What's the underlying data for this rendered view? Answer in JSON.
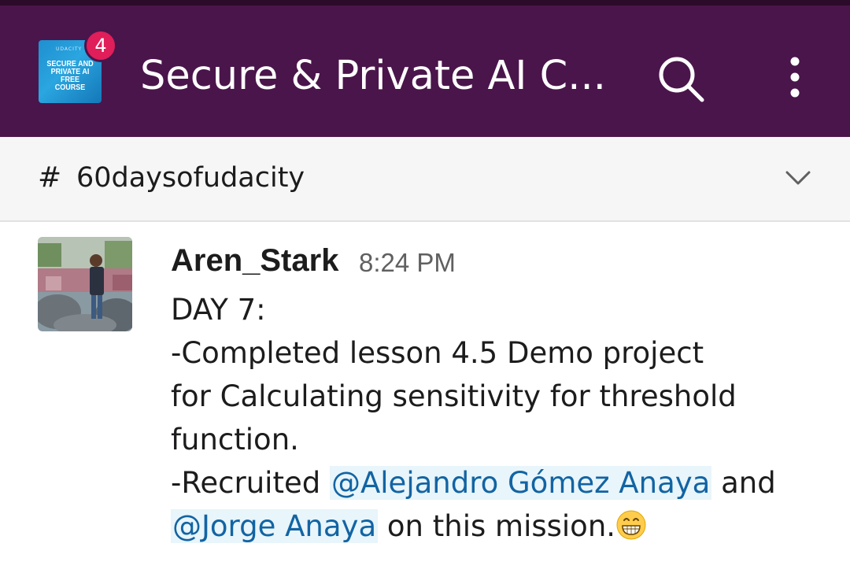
{
  "header": {
    "workspace_logo_text": "SECURE AND PRIVATE AI FREE COURSE",
    "workspace_logo_mark": "UDACITY",
    "notification_count": "4",
    "workspace_title": "Secure & Private AI C...",
    "search_icon": "search-icon",
    "more_icon": "more-vertical-icon",
    "background_color": "#4a154b",
    "badge_color": "#e01e5a"
  },
  "channel": {
    "hash": "#",
    "name": "60daysofudacity",
    "chevron_icon": "chevron-down-icon"
  },
  "message": {
    "author": "Aren_Stark",
    "time": "8:24 PM",
    "line1": "DAY 7:",
    "line2": "-Completed lesson 4.5 Demo project",
    "line3": "for Calculating sensitivity for threshold",
    "line4": "function.",
    "line5_prefix": "-Recruited ",
    "mention1": "@Alejandro Gómez Anaya",
    "line5_suffix": " and",
    "mention2": "@Jorge Anaya",
    "line6_suffix": " on this mission.",
    "emoji": "grinning-face-emoji",
    "mention_color": "#1264a3"
  }
}
